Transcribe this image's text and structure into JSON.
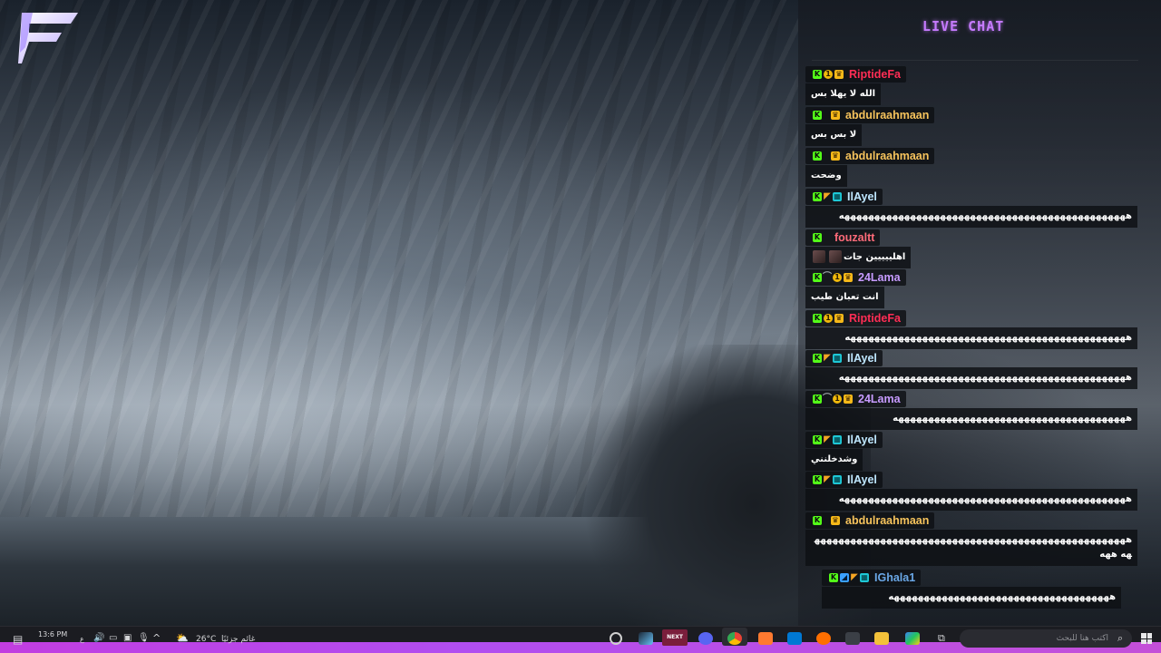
{
  "chat": {
    "title": "LIVE CHAT",
    "messages": [
      {
        "user": "RiptideFa",
        "color": "#ff2d55",
        "badges": [
          "kick",
          "coin",
          "crown"
        ],
        "text": "الله لا يهلا بس"
      },
      {
        "user": "abdulraahmaan",
        "color": "#f6c35c",
        "badges": [
          "kick",
          "blank",
          "crown"
        ],
        "text": "لا بس بس"
      },
      {
        "user": "abdulraahmaan",
        "color": "#f6c35c",
        "badges": [
          "kick",
          "blank",
          "crown"
        ],
        "text": "وضحت"
      },
      {
        "user": "IlAyel",
        "color": "#bfe7ff",
        "badges": [
          "kick",
          "flag",
          "cyan"
        ],
        "text": "ههههههههههههههههههههههههههههههههههههههههههههههههه"
      },
      {
        "user": "fouzaltt",
        "color": "#ff6b7a",
        "badges": [
          "kick",
          "blank"
        ],
        "text": "اهلييييين جات"
      },
      {
        "user": "24Lama",
        "color": "#c79bff",
        "badges": [
          "kick",
          "tilde",
          "coin",
          "crown"
        ],
        "text": "انت تعبان طيب"
      },
      {
        "user": "RiptideFa",
        "color": "#ff2d55",
        "badges": [
          "kick",
          "coin",
          "crown"
        ],
        "text": "هههههههههههههههههههههههههههههههههههههههههههههههه"
      },
      {
        "user": "IlAyel",
        "color": "#bfe7ff",
        "badges": [
          "kick",
          "flag",
          "cyan"
        ],
        "text": "ههههههههههههههههههههههههههههههههههههههههههههههههه"
      },
      {
        "user": "24Lama",
        "color": "#c79bff",
        "badges": [
          "kick",
          "tilde",
          "coin",
          "crown"
        ],
        "text": "هههههههههههههههههههههههههههههههههههههههه"
      },
      {
        "user": "IlAyel",
        "color": "#bfe7ff",
        "badges": [
          "kick",
          "flag",
          "cyan"
        ],
        "text": "وشدخلنني"
      },
      {
        "user": "IlAyel",
        "color": "#bfe7ff",
        "badges": [
          "kick",
          "flag",
          "cyan"
        ],
        "text": "ههههههههههههههههههههههههههههههههههههههههههههههههه"
      },
      {
        "user": "abdulraahmaan",
        "color": "#f6c35c",
        "badges": [
          "kick",
          "blank",
          "crown"
        ],
        "text": "ههههههههههههههههههههههههههههههههههههههههههههههههههههههه ههه"
      },
      {
        "user": "IGhala1",
        "color": "#6aa7e6",
        "badges": [
          "kick",
          "blue",
          "flag",
          "cyan"
        ],
        "text": "هههههههههههههههههههههههههههههههههههههه"
      }
    ]
  },
  "taskbar": {
    "time": "13:6 PM",
    "weather": "26°C",
    "weather_desc": "غائم جزئيًا",
    "search_placeholder": "اكتب هنا للبحث",
    "app_label": "NEXT"
  },
  "colors": {
    "accent": "#c67bff",
    "taskbar_glow": "#b14ef0",
    "kick_green": "#53fc18"
  },
  "icons": {
    "logo": "stylized-f-logo",
    "kick_badge": "kick-badge-icon",
    "crown_badge": "crown-badge-icon"
  }
}
